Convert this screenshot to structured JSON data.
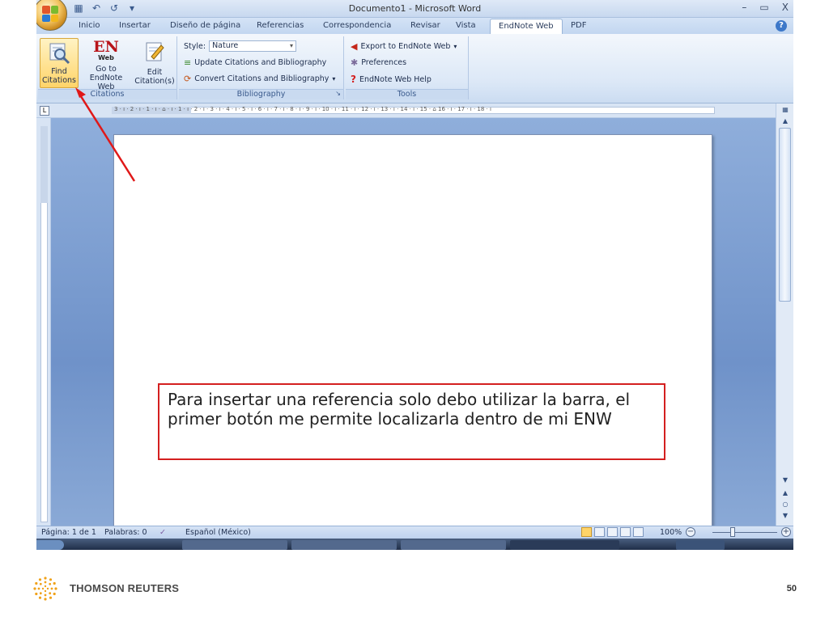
{
  "window": {
    "title": "Documento1 - Microsoft Word",
    "controls": [
      "–",
      "▭",
      "X"
    ]
  },
  "quick_access": {
    "icons": [
      "save-icon",
      "undo-icon",
      "redo-icon",
      "customize-icon"
    ]
  },
  "tabs": [
    {
      "label": "Inicio"
    },
    {
      "label": "Insertar"
    },
    {
      "label": "Diseño de página"
    },
    {
      "label": "Referencias"
    },
    {
      "label": "Correspondencia"
    },
    {
      "label": "Revisar"
    },
    {
      "label": "Vista"
    },
    {
      "label": "EndNote Web",
      "active": true
    },
    {
      "label": "PDF"
    }
  ],
  "ribbon": {
    "citations": {
      "label": "Citations",
      "find_line1": "Find",
      "find_line2": "Citations",
      "goto_logo_main": "EN",
      "goto_logo_sub": "Web",
      "goto_line1": "Go to",
      "goto_line2": "EndNote Web",
      "edit_line1": "Edit",
      "edit_line2": "Citation(s)"
    },
    "bibliography": {
      "label": "Bibliography",
      "style_label": "Style:",
      "style_value": "Nature",
      "update": "Update Citations and Bibliography",
      "convert": "Convert Citations and Bibliography"
    },
    "tools": {
      "label": "Tools",
      "export": "Export to EndNote Web",
      "preferences": "Preferences",
      "help": "EndNote Web Help"
    }
  },
  "ruler": {
    "top_ticks": "3 · ı · 2 · ı · 1 · ı · ⌂ · ı · 1 · ı · 2 · ı · 3 · ı · 4 · ı · 5 · ı · 6 · ı · 7 · ı · 8 · ı · 9 · ı · 10 · ı · 11 · ı · 12 · ı · 13 · ı · 14 · ı · 15 · ⌂ 16 · ı · 17 · ı · 18 · ı"
  },
  "status": {
    "page": "Página: 1 de 1",
    "words": "Palabras: 0",
    "language": "Español (México)",
    "zoom": "100%"
  },
  "callout": {
    "text": "Para insertar una referencia solo debo utilizar la barra, el primer botón me permite localizarla dentro de mi ENW"
  },
  "footer": {
    "brand": "THOMSON REUTERS",
    "page_number": "50"
  },
  "colors": {
    "callout_border": "#d41f1f",
    "ribbon_accent": "#ffd469",
    "workspace": "#7f9fd2"
  }
}
